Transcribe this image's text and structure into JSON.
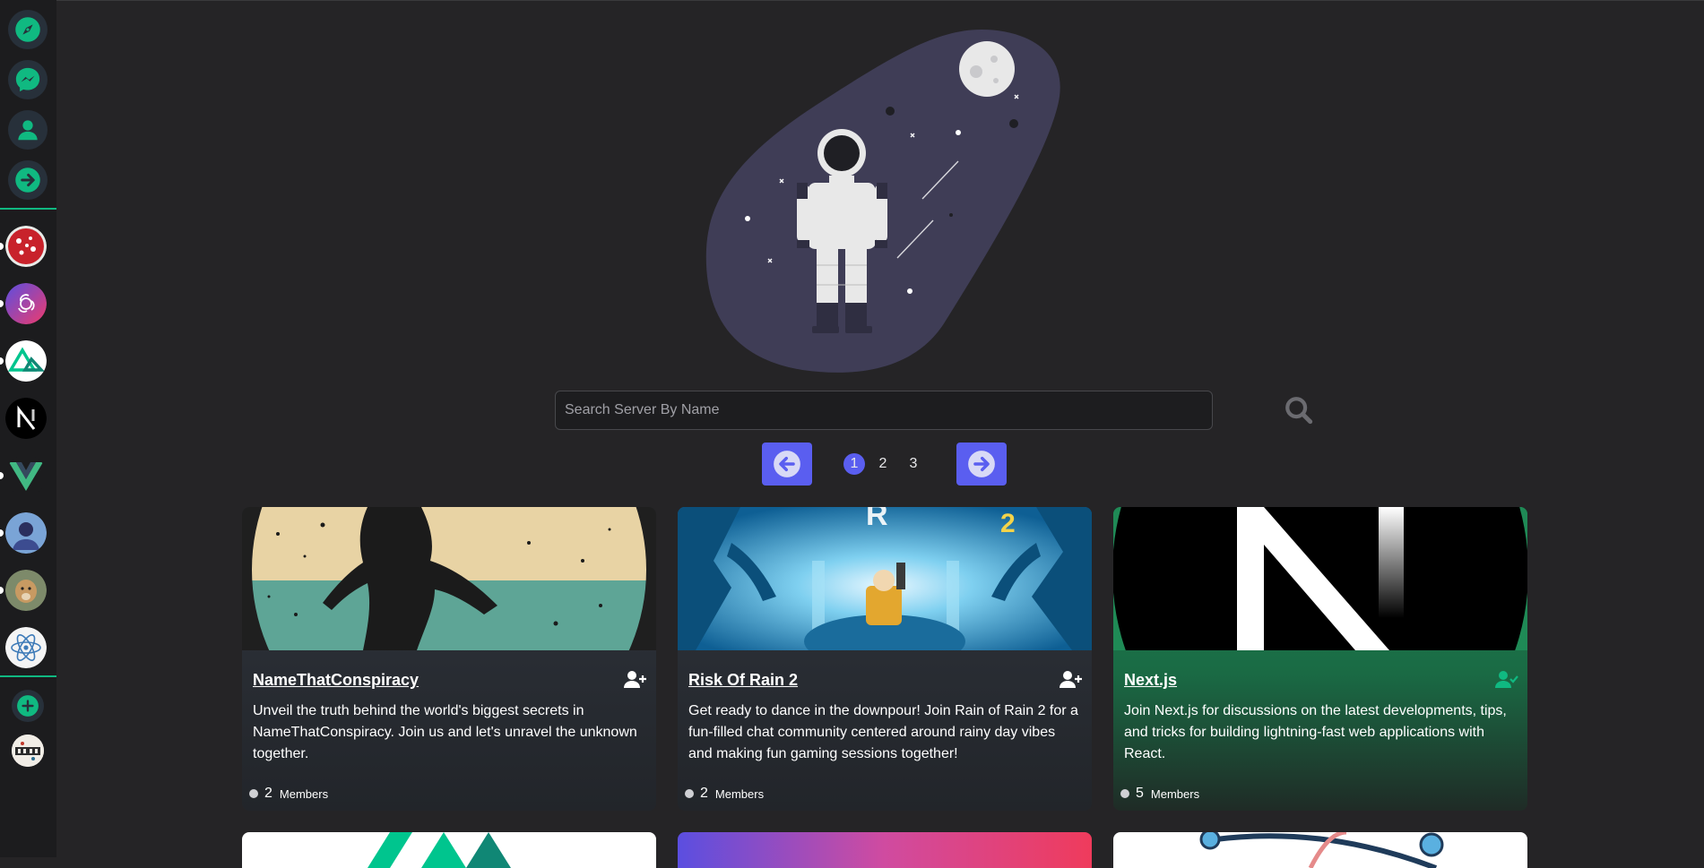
{
  "sidebar": {
    "nav": [
      {
        "name": "explore",
        "icon": "compass-icon"
      },
      {
        "name": "messages",
        "icon": "messenger-icon"
      },
      {
        "name": "profile",
        "icon": "user-icon"
      },
      {
        "name": "logout",
        "icon": "arrow-right-circle-icon"
      }
    ],
    "servers": [
      "NameThatConspiracy avatar",
      "OpenAI avatar",
      "Nuxt avatar",
      "Next.js avatar",
      "Vue avatar",
      "Person avatar",
      "Dog avatar",
      "React avatar"
    ]
  },
  "search": {
    "placeholder": "Search Server By Name"
  },
  "pagination": {
    "pages": [
      "1",
      "2",
      "3"
    ],
    "current": "1"
  },
  "cards": [
    {
      "title": "NameThatConspiracy",
      "description": "Unveil the truth behind the world's biggest secrets in NameThatConspiracy. Join us and let's unravel the unknown together.",
      "members_count": "2",
      "members_label": "Members",
      "joined": false
    },
    {
      "title": "Risk Of Rain 2",
      "description": "Get ready to dance in the downpour! Join Rain of Rain 2 for a fun-filled chat community centered around rainy day vibes and making fun gaming sessions together!",
      "members_count": "2",
      "members_label": "Members",
      "joined": false
    },
    {
      "title": "Next.js",
      "description": "Join Next.js for discussions on the latest developments, tips, and tricks for building lightning-fast web applications with React.",
      "members_count": "5",
      "members_label": "Members",
      "joined": true
    }
  ],
  "colors": {
    "accent": "#10b981",
    "primary": "#5a5ef0",
    "background": "#252426",
    "sidebar": "#1c1c1e"
  }
}
